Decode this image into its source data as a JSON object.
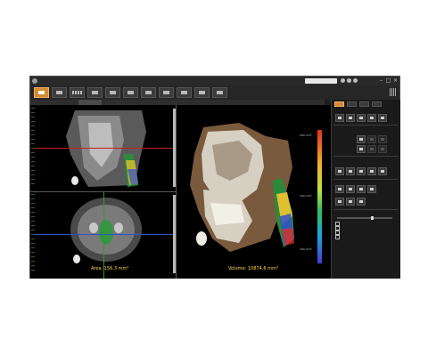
{
  "window": {
    "tool_icons": [
      "zoom-in-icon",
      "zoom-out-icon",
      "window-restore-icon"
    ],
    "controls": [
      "minimize-icon",
      "maximize-icon",
      "close-icon"
    ]
  },
  "toolbar": {
    "buttons": [
      {
        "icon": "open-case-icon",
        "active": true
      },
      {
        "icon": "patient-icon",
        "active": false
      },
      {
        "icon": "film-strip-icon",
        "active": false
      },
      {
        "icon": "layout-icon",
        "active": false
      },
      {
        "icon": "volume-icon",
        "active": false
      },
      {
        "icon": "cut-icon",
        "active": false
      },
      {
        "icon": "rotate-3d-icon",
        "active": false
      },
      {
        "icon": "implant-icon",
        "active": false
      },
      {
        "icon": "wrench-icon",
        "active": false
      },
      {
        "icon": "report-icon",
        "active": false
      },
      {
        "icon": "export-icon",
        "active": false
      }
    ],
    "logo_icon": "vendor-logo-icon"
  },
  "tabs": [
    "",
    "",
    ""
  ],
  "viewer": {
    "area_measurement": "Area: 156.3 mm²",
    "volume_measurement": "Volume: 10874.6 mm³",
    "scale_labels": [
      "200 mm²",
      "150 mm²",
      "100 mm²"
    ],
    "colors": {
      "crosshair_red": "#c81e1e",
      "crosshair_green": "#2f9a2f",
      "crosshair_blue": "#3050d0",
      "measure_text": "#ffd84a"
    }
  },
  "panel": {
    "tabs": [
      {
        "icon": "airway-icon",
        "active": true
      },
      {
        "icon": "display-icon",
        "active": false
      },
      {
        "icon": "settings-icon",
        "active": false
      },
      {
        "icon": "help-icon",
        "active": false
      }
    ],
    "sections": [
      "",
      "",
      "",
      "",
      "",
      ""
    ],
    "checkbox_rows": [
      "",
      "",
      "",
      ""
    ],
    "accent_color": "#d48a32"
  }
}
